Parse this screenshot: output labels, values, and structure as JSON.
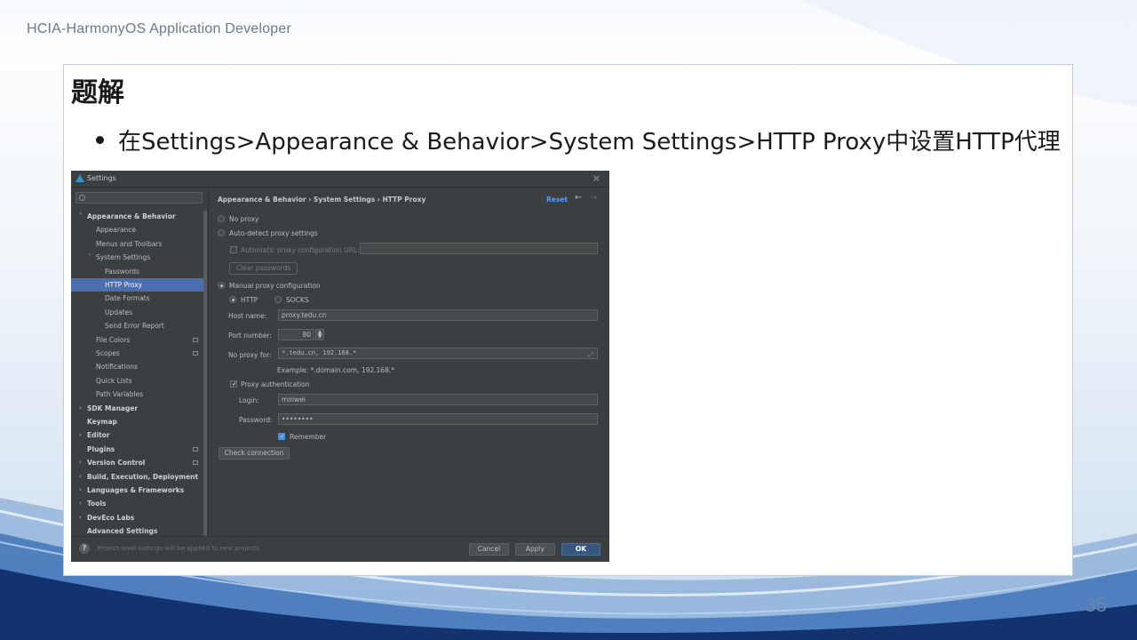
{
  "header": {
    "brand": "HCIA-HarmonyOS Application Developer",
    "page_number": "35"
  },
  "slide": {
    "title": "题解",
    "bullet": "在Settings>Appearance & Behavior>System Settings>HTTP Proxy中设置HTTP代理"
  },
  "dialog": {
    "title": "Settings",
    "search": {
      "placeholder": "Q•"
    },
    "sidebar": {
      "items": [
        {
          "label": "Appearance & Behavior",
          "level": 0,
          "bold": true,
          "arrow": "v"
        },
        {
          "label": "Appearance",
          "level": 1
        },
        {
          "label": "Menus and Toolbars",
          "level": 1
        },
        {
          "label": "System Settings",
          "level": 1,
          "arrow": "v"
        },
        {
          "label": "Passwords",
          "level": 2
        },
        {
          "label": "HTTP Proxy",
          "level": 2,
          "selected": true
        },
        {
          "label": "Date Formats",
          "level": 2
        },
        {
          "label": "Updates",
          "level": 2
        },
        {
          "label": "Send Error Report",
          "level": 2
        },
        {
          "label": "File Colors",
          "level": 1,
          "badge": true
        },
        {
          "label": "Scopes",
          "level": 1,
          "badge": true
        },
        {
          "label": "Notifications",
          "level": 1
        },
        {
          "label": "Quick Lists",
          "level": 1
        },
        {
          "label": "Path Variables",
          "level": 1
        },
        {
          "label": "SDK Manager",
          "level": 0,
          "bold": true,
          "arrow": ">"
        },
        {
          "label": "Keymap",
          "level": 0,
          "bold": true
        },
        {
          "label": "Editor",
          "level": 0,
          "bold": true,
          "arrow": ">"
        },
        {
          "label": "Plugins",
          "level": 0,
          "bold": true,
          "badge": true
        },
        {
          "label": "Version Control",
          "level": 0,
          "bold": true,
          "arrow": ">",
          "badge": true
        },
        {
          "label": "Build, Execution, Deployment",
          "level": 0,
          "bold": true,
          "arrow": ">"
        },
        {
          "label": "Languages & Frameworks",
          "level": 0,
          "bold": true,
          "arrow": ">"
        },
        {
          "label": "Tools",
          "level": 0,
          "bold": true,
          "arrow": ">"
        },
        {
          "label": "DevEco Labs",
          "level": 0,
          "bold": true,
          "arrow": ">"
        },
        {
          "label": "Advanced Settings",
          "level": 0,
          "bold": true
        }
      ]
    },
    "breadcrumb": "Appearance & Behavior  ›  System Settings  ›  HTTP Proxy",
    "reset_label": "Reset",
    "proxy": {
      "no_proxy_label": "No proxy",
      "auto_detect_label": "Auto-detect proxy settings",
      "auto_config_url_label": "Automatic proxy configuration URL:",
      "auto_config_url_value": "",
      "clear_passwords_label": "Clear passwords",
      "manual_label": "Manual proxy configuration",
      "http_label": "HTTP",
      "socks_label": "SOCKS",
      "host_name_label": "Host name:",
      "host_name_value": "proxy.tedu.cn",
      "port_number_label": "Port number:",
      "port_number_value": "80",
      "no_proxy_for_label": "No proxy for:",
      "no_proxy_for_value": "*.tedu.cn, 192.168.*",
      "example_text": "Example: *.domain.com, 192.168.*",
      "proxy_auth_label": "Proxy authentication",
      "login_label": "Login:",
      "login_value": "minwei",
      "password_label": "Password:",
      "password_value": "••••••••",
      "remember_label": "Remember",
      "check_connection_label": "Check connection"
    },
    "footer": {
      "note": "Project-level settings will be applied to new projects",
      "cancel_label": "Cancel",
      "apply_label": "Apply",
      "ok_label": "OK"
    }
  }
}
